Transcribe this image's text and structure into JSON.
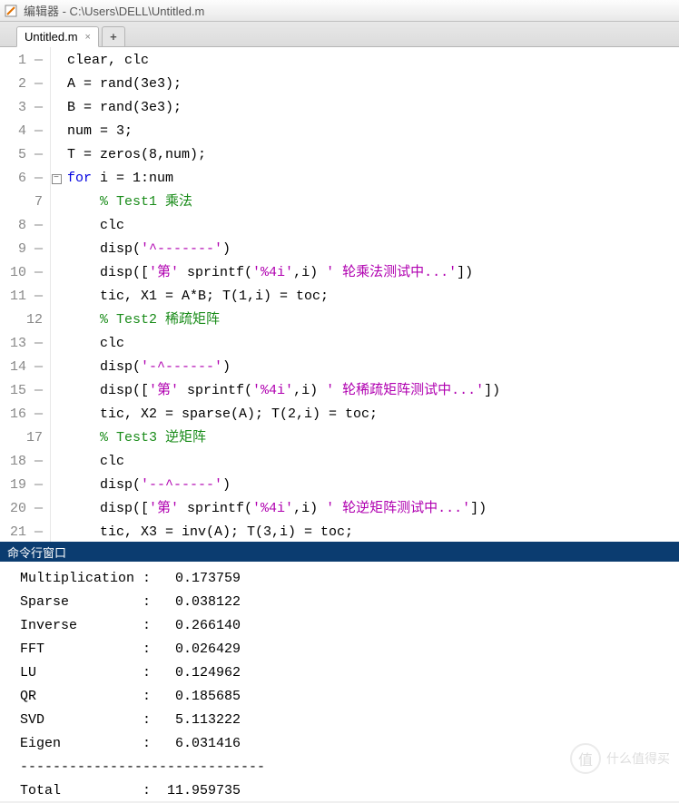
{
  "title": "编辑器 - C:\\Users\\DELL\\Untitled.m",
  "tab": {
    "name": "Untitled.m",
    "close": "×",
    "plus": "+"
  },
  "code": {
    "lines": [
      {
        "n": "1",
        "dash": "—",
        "fold": "",
        "segs": [
          {
            "t": "clear, clc",
            "c": ""
          }
        ]
      },
      {
        "n": "2",
        "dash": "—",
        "fold": "",
        "segs": [
          {
            "t": "A = rand(3e3);",
            "c": ""
          }
        ]
      },
      {
        "n": "3",
        "dash": "—",
        "fold": "",
        "segs": [
          {
            "t": "B = rand(3e3);",
            "c": ""
          }
        ]
      },
      {
        "n": "4",
        "dash": "—",
        "fold": "",
        "segs": [
          {
            "t": "num = 3;",
            "c": ""
          }
        ]
      },
      {
        "n": "5",
        "dash": "—",
        "fold": "",
        "segs": [
          {
            "t": "T = zeros(8,num);",
            "c": ""
          }
        ]
      },
      {
        "n": "6",
        "dash": "—",
        "fold": "box",
        "segs": [
          {
            "t": "for",
            "c": "kw"
          },
          {
            "t": " i = 1:num",
            "c": ""
          }
        ]
      },
      {
        "n": "7",
        "dash": "",
        "fold": "",
        "segs": [
          {
            "t": "    ",
            "c": ""
          },
          {
            "t": "% Test1 乘法",
            "c": "cm"
          }
        ]
      },
      {
        "n": "8",
        "dash": "—",
        "fold": "",
        "segs": [
          {
            "t": "    clc",
            "c": ""
          }
        ]
      },
      {
        "n": "9",
        "dash": "—",
        "fold": "",
        "segs": [
          {
            "t": "    disp(",
            "c": ""
          },
          {
            "t": "'^-------'",
            "c": "st"
          },
          {
            "t": ")",
            "c": ""
          }
        ]
      },
      {
        "n": "10",
        "dash": "—",
        "fold": "",
        "segs": [
          {
            "t": "    disp([",
            "c": ""
          },
          {
            "t": "'第'",
            "c": "st"
          },
          {
            "t": " sprintf(",
            "c": ""
          },
          {
            "t": "'%4i'",
            "c": "st"
          },
          {
            "t": ",i) ",
            "c": ""
          },
          {
            "t": "' 轮乘法测试中...'",
            "c": "st"
          },
          {
            "t": "])",
            "c": ""
          }
        ]
      },
      {
        "n": "11",
        "dash": "—",
        "fold": "",
        "segs": [
          {
            "t": "    tic, X1 = A*B; T(1,i) = toc;",
            "c": ""
          }
        ]
      },
      {
        "n": "12",
        "dash": "",
        "fold": "",
        "segs": [
          {
            "t": "    ",
            "c": ""
          },
          {
            "t": "% Test2 稀疏矩阵",
            "c": "cm"
          }
        ]
      },
      {
        "n": "13",
        "dash": "—",
        "fold": "",
        "segs": [
          {
            "t": "    clc",
            "c": ""
          }
        ]
      },
      {
        "n": "14",
        "dash": "—",
        "fold": "",
        "segs": [
          {
            "t": "    disp(",
            "c": ""
          },
          {
            "t": "'-^------'",
            "c": "st"
          },
          {
            "t": ")",
            "c": ""
          }
        ]
      },
      {
        "n": "15",
        "dash": "—",
        "fold": "",
        "segs": [
          {
            "t": "    disp([",
            "c": ""
          },
          {
            "t": "'第'",
            "c": "st"
          },
          {
            "t": " sprintf(",
            "c": ""
          },
          {
            "t": "'%4i'",
            "c": "st"
          },
          {
            "t": ",i) ",
            "c": ""
          },
          {
            "t": "' 轮稀疏矩阵测试中...'",
            "c": "st"
          },
          {
            "t": "])",
            "c": ""
          }
        ]
      },
      {
        "n": "16",
        "dash": "—",
        "fold": "",
        "segs": [
          {
            "t": "    tic, X2 = sparse(A); T(2,i) = toc;",
            "c": ""
          }
        ]
      },
      {
        "n": "17",
        "dash": "",
        "fold": "",
        "segs": [
          {
            "t": "    ",
            "c": ""
          },
          {
            "t": "% Test3 逆矩阵",
            "c": "cm"
          }
        ]
      },
      {
        "n": "18",
        "dash": "—",
        "fold": "",
        "segs": [
          {
            "t": "    clc",
            "c": ""
          }
        ]
      },
      {
        "n": "19",
        "dash": "—",
        "fold": "",
        "segs": [
          {
            "t": "    disp(",
            "c": ""
          },
          {
            "t": "'--^-----'",
            "c": "st"
          },
          {
            "t": ")",
            "c": ""
          }
        ]
      },
      {
        "n": "20",
        "dash": "—",
        "fold": "",
        "segs": [
          {
            "t": "    disp([",
            "c": ""
          },
          {
            "t": "'第'",
            "c": "st"
          },
          {
            "t": " sprintf(",
            "c": ""
          },
          {
            "t": "'%4i'",
            "c": "st"
          },
          {
            "t": ",i) ",
            "c": ""
          },
          {
            "t": "' 轮逆矩阵测试中...'",
            "c": "st"
          },
          {
            "t": "])",
            "c": ""
          }
        ]
      },
      {
        "n": "21",
        "dash": "—",
        "fold": "",
        "segs": [
          {
            "t": "    tic, X3 = inv(A); T(3,i) = toc;",
            "c": ""
          }
        ]
      }
    ]
  },
  "console": {
    "title": "命令行窗口",
    "rows": [
      "Multiplication :   0.173759",
      "Sparse         :   0.038122",
      "Inverse        :   0.266140",
      "FFT            :   0.026429",
      "LU             :   0.124962",
      "QR             :   0.185685",
      "SVD            :   5.113222",
      "Eigen          :   6.031416",
      "------------------------------",
      "Total          :  11.959735"
    ]
  },
  "watermark": "什么值得买"
}
